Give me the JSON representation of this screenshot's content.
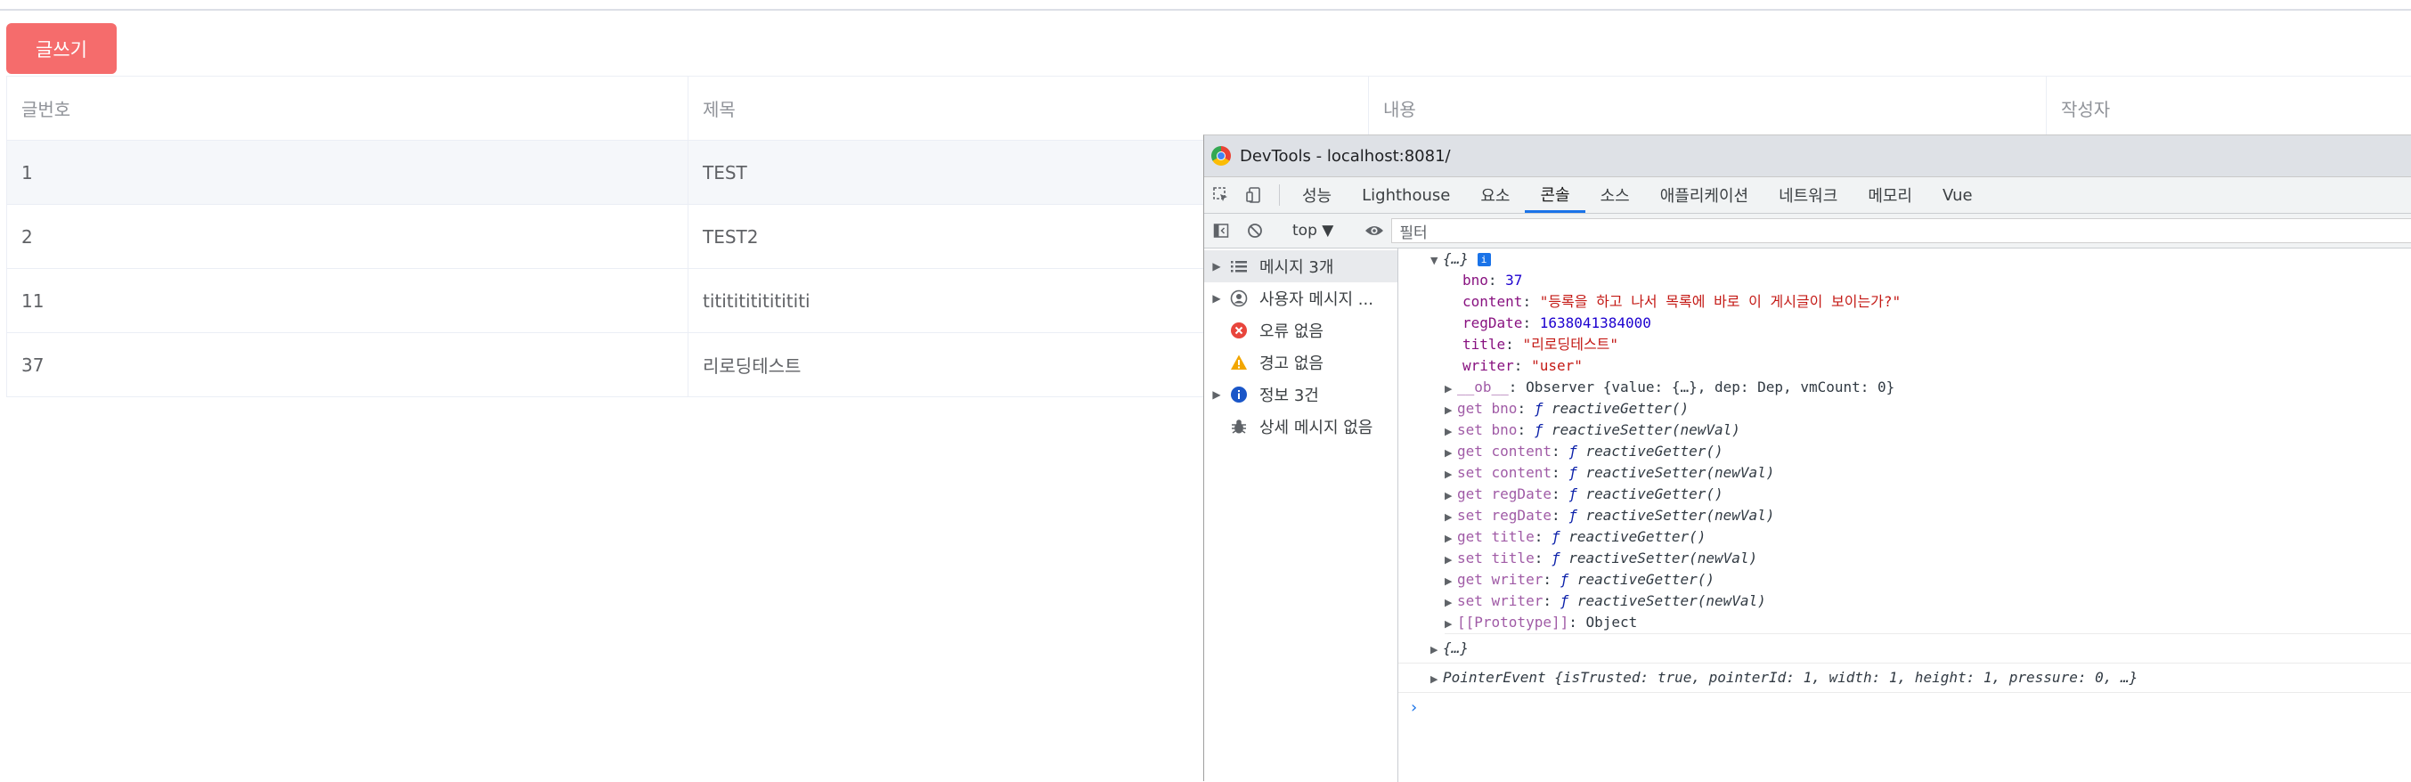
{
  "write_button": "글쓰기",
  "table": {
    "headers": [
      "글번호",
      "제목",
      "내용",
      "작성자"
    ],
    "rows": [
      {
        "bno": "1",
        "title": "TEST"
      },
      {
        "bno": "2",
        "title": "TEST2"
      },
      {
        "bno": "11",
        "title": "tititititititititi"
      },
      {
        "bno": "37",
        "title": "리로딩테스트"
      }
    ]
  },
  "devtools": {
    "window_title": "DevTools - localhost:8081/",
    "tabs": [
      "성능",
      "Lighthouse",
      "요소",
      "콘솔",
      "소스",
      "애플리케이션",
      "네트워크",
      "메모리",
      "Vue"
    ],
    "active_tab": "콘솔",
    "context": "top ▼",
    "filter_placeholder": "필터",
    "sidebar": [
      {
        "label": "메시지 3개",
        "icon": "list-icon"
      },
      {
        "label": "사용자 메시지 ...",
        "icon": "user-icon"
      },
      {
        "label": "오류 없음",
        "icon": "error-icon"
      },
      {
        "label": "경고 없음",
        "icon": "warning-icon"
      },
      {
        "label": "정보 3건",
        "icon": "info-icon"
      },
      {
        "label": "상세 메시지 없음",
        "icon": "bug-icon"
      }
    ],
    "console": {
      "obj_label": "{…}",
      "props": {
        "bno": "37",
        "content": "\"등록을 하고 나서 목록에 바로 이 게시글이 보이는가?\"",
        "regDate": "1638041384000",
        "title": "\"리로딩테스트\"",
        "writer": "\"user\""
      },
      "ob_line": "Observer {value: {…}, dep: Dep, vmCount: 0}",
      "accessors": [
        {
          "prefix": "get bno",
          "fn": "reactiveGetter()"
        },
        {
          "prefix": "set bno",
          "fn": "reactiveSetter(newVal)"
        },
        {
          "prefix": "get content",
          "fn": "reactiveGetter()"
        },
        {
          "prefix": "set content",
          "fn": "reactiveSetter(newVal)"
        },
        {
          "prefix": "get regDate",
          "fn": "reactiveGetter()"
        },
        {
          "prefix": "set regDate",
          "fn": "reactiveSetter(newVal)"
        },
        {
          "prefix": "get title",
          "fn": "reactiveGetter()"
        },
        {
          "prefix": "set title",
          "fn": "reactiveSetter(newVal)"
        },
        {
          "prefix": "get writer",
          "fn": "reactiveGetter()"
        },
        {
          "prefix": "set writer",
          "fn": "reactiveSetter(newVal)"
        }
      ],
      "prototype": "Object",
      "second_obj": "{…}",
      "pointer_event": "PointerEvent {isTrusted: true, pointerId: 1, width: 1, height: 1, pressure: 0, …}",
      "prompt": "›"
    }
  },
  "colors": {
    "button": "#f56c6c",
    "accent": "#1a73e8"
  }
}
